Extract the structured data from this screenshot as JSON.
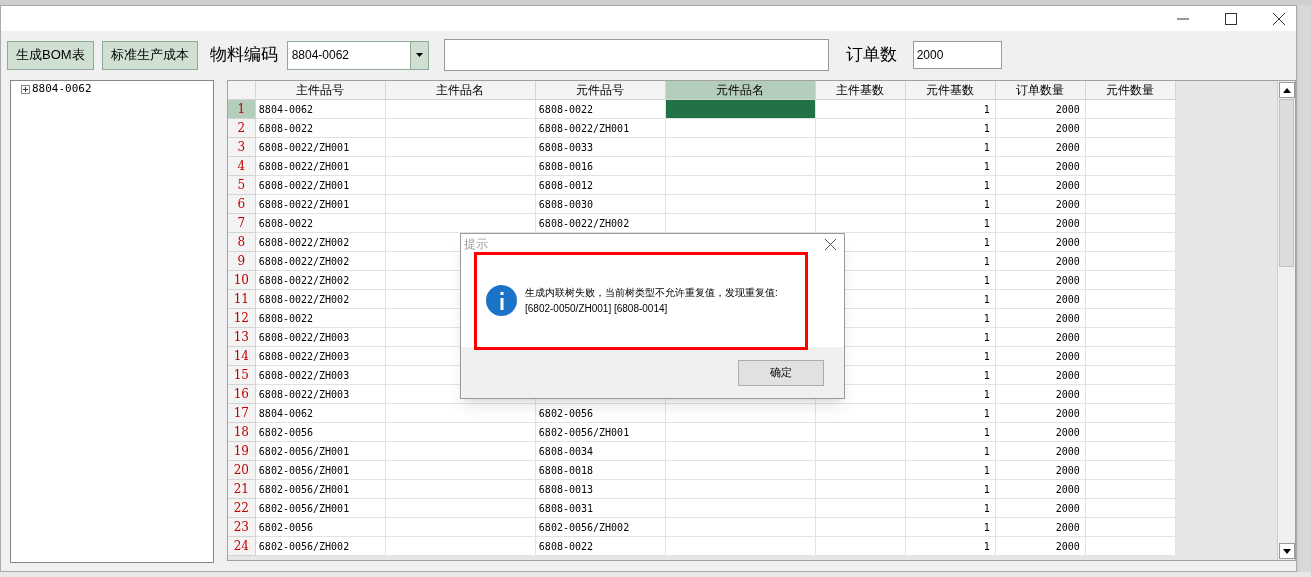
{
  "toolbar": {
    "buttons": [
      "生成BOM表",
      "标准生产成本"
    ],
    "material_label": "物料编码",
    "material_combo": {
      "value": "8804-0062"
    },
    "order_label": "订单数",
    "order_field": {
      "value": "2000"
    }
  },
  "tree": {
    "items": [
      {
        "label": "8804-0062",
        "expanded": false
      }
    ]
  },
  "grid": {
    "columns": [
      {
        "label": "主件品号",
        "selected": false
      },
      {
        "label": "主件品名",
        "selected": false
      },
      {
        "label": "元件品号",
        "selected": false
      },
      {
        "label": "元件品名",
        "selected": true
      },
      {
        "label": "主件基数",
        "selected": false
      },
      {
        "label": "元件基数",
        "selected": false
      },
      {
        "label": "订单数量",
        "selected": false
      },
      {
        "label": "元件数量",
        "selected": false
      }
    ],
    "rows": [
      {
        "number": "1",
        "selected": true,
        "cells": [
          "8804-0062",
          null,
          "6808-0022",
          null,
          null,
          "1",
          "2000",
          null
        ]
      },
      {
        "number": "2",
        "selected": false,
        "cells": [
          "6808-0022",
          null,
          "6808-0022/ZH001",
          null,
          null,
          "1",
          "2000",
          null
        ]
      },
      {
        "number": "3",
        "selected": false,
        "cells": [
          "6808-0022/ZH001",
          null,
          "6808-0033",
          null,
          null,
          "1",
          "2000",
          null
        ]
      },
      {
        "number": "4",
        "selected": false,
        "cells": [
          "6808-0022/ZH001",
          null,
          "6808-0016",
          null,
          null,
          "1",
          "2000",
          null
        ]
      },
      {
        "number": "5",
        "selected": false,
        "cells": [
          "6808-0022/ZH001",
          null,
          "6808-0012",
          null,
          null,
          "1",
          "2000",
          null
        ]
      },
      {
        "number": "6",
        "selected": false,
        "cells": [
          "6808-0022/ZH001",
          null,
          "6808-0030",
          null,
          null,
          "1",
          "2000",
          null
        ]
      },
      {
        "number": "7",
        "selected": false,
        "cells": [
          "6808-0022",
          null,
          "6808-0022/ZH002",
          null,
          null,
          "1",
          "2000",
          null
        ]
      },
      {
        "number": "8",
        "selected": false,
        "cells": [
          "6808-0022/ZH002",
          null,
          null,
          null,
          null,
          "1",
          "2000",
          null
        ]
      },
      {
        "number": "9",
        "selected": false,
        "cells": [
          "6808-0022/ZH002",
          null,
          null,
          null,
          null,
          "1",
          "2000",
          null
        ]
      },
      {
        "number": "10",
        "selected": false,
        "cells": [
          "6808-0022/ZH002",
          null,
          null,
          null,
          null,
          "1",
          "2000",
          null
        ]
      },
      {
        "number": "11",
        "selected": false,
        "cells": [
          "6808-0022/ZH002",
          null,
          null,
          null,
          null,
          "1",
          "2000",
          null
        ]
      },
      {
        "number": "12",
        "selected": false,
        "cells": [
          "6808-0022",
          null,
          null,
          null,
          null,
          "1",
          "2000",
          null
        ]
      },
      {
        "number": "13",
        "selected": false,
        "cells": [
          "6808-0022/ZH003",
          null,
          null,
          null,
          null,
          "1",
          "2000",
          null
        ]
      },
      {
        "number": "14",
        "selected": false,
        "cells": [
          "6808-0022/ZH003",
          null,
          null,
          null,
          null,
          "1",
          "2000",
          null
        ]
      },
      {
        "number": "15",
        "selected": false,
        "cells": [
          "6808-0022/ZH003",
          null,
          null,
          null,
          null,
          "1",
          "2000",
          null
        ]
      },
      {
        "number": "16",
        "selected": false,
        "cells": [
          "6808-0022/ZH003",
          null,
          null,
          null,
          null,
          "1",
          "2000",
          null
        ]
      },
      {
        "number": "17",
        "selected": false,
        "cells": [
          "8804-0062",
          null,
          "6802-0056",
          null,
          null,
          "1",
          "2000",
          null
        ]
      },
      {
        "number": "18",
        "selected": false,
        "cells": [
          "6802-0056",
          null,
          "6802-0056/ZH001",
          null,
          null,
          "1",
          "2000",
          null
        ]
      },
      {
        "number": "19",
        "selected": false,
        "cells": [
          "6802-0056/ZH001",
          null,
          "6808-0034",
          null,
          null,
          "1",
          "2000",
          null
        ]
      },
      {
        "number": "20",
        "selected": false,
        "cells": [
          "6802-0056/ZH001",
          null,
          "6808-0018",
          null,
          null,
          "1",
          "2000",
          null
        ]
      },
      {
        "number": "21",
        "selected": false,
        "cells": [
          "6802-0056/ZH001",
          null,
          "6808-0013",
          null,
          null,
          "1",
          "2000",
          null
        ]
      },
      {
        "number": "22",
        "selected": false,
        "cells": [
          "6802-0056/ZH001",
          null,
          "6808-0031",
          null,
          null,
          "1",
          "2000",
          null
        ]
      },
      {
        "number": "23",
        "selected": false,
        "cells": [
          "6802-0056",
          null,
          "6802-0056/ZH002",
          null,
          null,
          "1",
          "2000",
          null
        ]
      },
      {
        "number": "24",
        "selected": false,
        "cells": [
          "6802-0056/ZH002",
          null,
          "6808-0022",
          null,
          null,
          "1",
          "2000",
          null
        ]
      }
    ]
  },
  "dialog": {
    "title": "提示",
    "message_lines": [
      "生成内联树失败，当前树类型不允许重复值，发现重复值:",
      "[6802-0050/ZH001] [6808-0014]"
    ],
    "button": "确定"
  }
}
